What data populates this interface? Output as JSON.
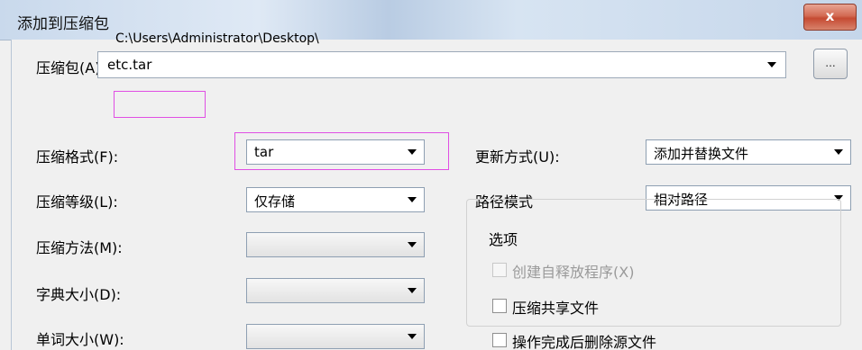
{
  "window": {
    "title": "添加到压缩包",
    "close_label": "x"
  },
  "archive": {
    "label": "压缩包(A)",
    "folder": "C:\\Users\\Administrator\\Desktop\\",
    "name_value": "etc.tar",
    "browse_label": "..."
  },
  "left_fields": [
    {
      "label": "压缩格式(F):",
      "value": "tar"
    },
    {
      "label": "压缩等级(L):",
      "value": "仅存储"
    },
    {
      "label": "压缩方法(M):",
      "value": ""
    },
    {
      "label": "字典大小(D):",
      "value": ""
    },
    {
      "label": "单词大小(W):",
      "value": ""
    }
  ],
  "right_fields": [
    {
      "label": "更新方式(U):",
      "value": "添加并替换文件"
    },
    {
      "label": "路径模式",
      "value": "相对路径"
    }
  ],
  "options": {
    "group_label": "选项",
    "items": [
      {
        "label": "创建自释放程序(X)",
        "checked": false,
        "disabled": true
      },
      {
        "label": "压缩共享文件",
        "checked": false,
        "disabled": false
      },
      {
        "label": "操作完成后删除源文件",
        "checked": false,
        "disabled": false
      }
    ]
  },
  "highlight_color": "#e04fe4"
}
